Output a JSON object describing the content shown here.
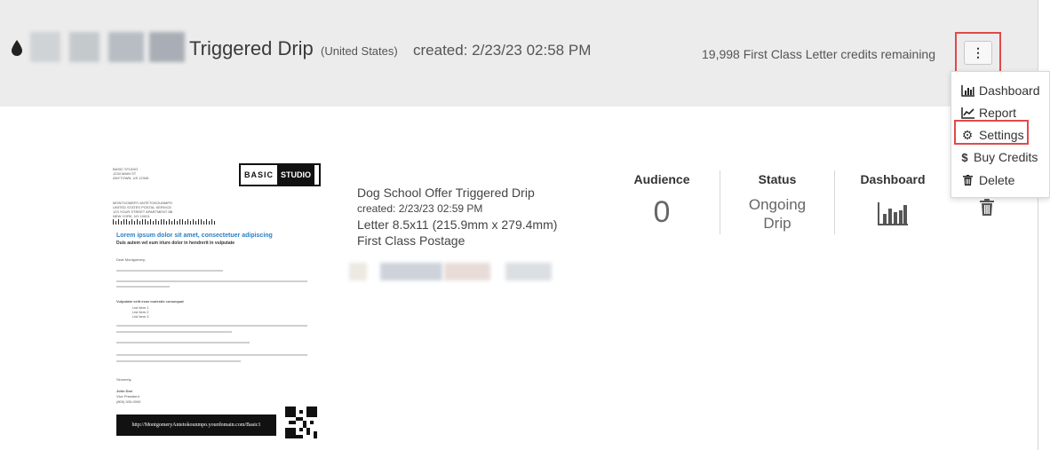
{
  "header": {
    "campaign_title": "Triggered Drip",
    "region": "(United States)",
    "created": "created: 2/23/23 02:58 PM",
    "credits_text": "19,998 First Class Letter credits remaining",
    "kebab_glyph": "⋮"
  },
  "icons": {
    "drop": "drop-icon",
    "kebab": "vertical-ellipsis-icon",
    "dashboard": "bar-chart-icon",
    "report": "line-chart-icon",
    "settings": "gear-icon",
    "buy_credits": "dollar-icon",
    "delete": "trash-icon"
  },
  "menu": {
    "items": [
      {
        "label": "Dashboard",
        "glyph": ""
      },
      {
        "label": "Report",
        "glyph": ""
      },
      {
        "label": "Settings",
        "glyph": "⚙"
      },
      {
        "label": "Buy Credits",
        "glyph": "$"
      },
      {
        "label": "Delete",
        "glyph": ""
      }
    ]
  },
  "letter": {
    "sender_lines": [
      "BASIC STUDIO",
      "1234 MAIN ST",
      "ANYTOWN, US 12345"
    ],
    "recipient_lines": [
      "MONTGOMERY ANTETOKOUNMPO",
      "UNITED STATES POSTAL SERVICE",
      "123 YOUR STREET APARTMENT 5B",
      "NEW YORK, NY 10001"
    ],
    "logo_left": "BASIC",
    "logo_right": "STUDIO",
    "headline": "Lorem ipsum dolor sit amet, consectetuer adipiscing",
    "subhead": "Duis autem vel eum iriure dolor in hendrerit in vulputate",
    "greeting": "Dear Montgomery,",
    "list_heading": "Vulputate velit esse molestie consequat",
    "list_items": [
      "List Item 1",
      "List Item 2",
      "List Item 3"
    ],
    "closing": "Sincerely,",
    "signer_name": "John Doe",
    "signer_title": "Vice President",
    "signer_phone": "(800) 000-0000",
    "url": "http://MontgomeryAntetokounmpo.yourdomain.com/Basic1"
  },
  "info": {
    "name": "Dog School Offer Triggered Drip",
    "created": "created: 2/23/23 02:59 PM",
    "size": "Letter 8.5x11 (215.9mm x 279.4mm)",
    "postage": "First Class Postage"
  },
  "stats": {
    "audience_label": "Audience",
    "audience_value": "0",
    "status_label": "Status",
    "status_line1": "Ongoing",
    "status_line2": "Drip",
    "dashboard_label": "Dashboard"
  },
  "colors": {
    "topbar": "#ececec",
    "highlight": "#e04a4a",
    "link": "#2a7fc4"
  }
}
